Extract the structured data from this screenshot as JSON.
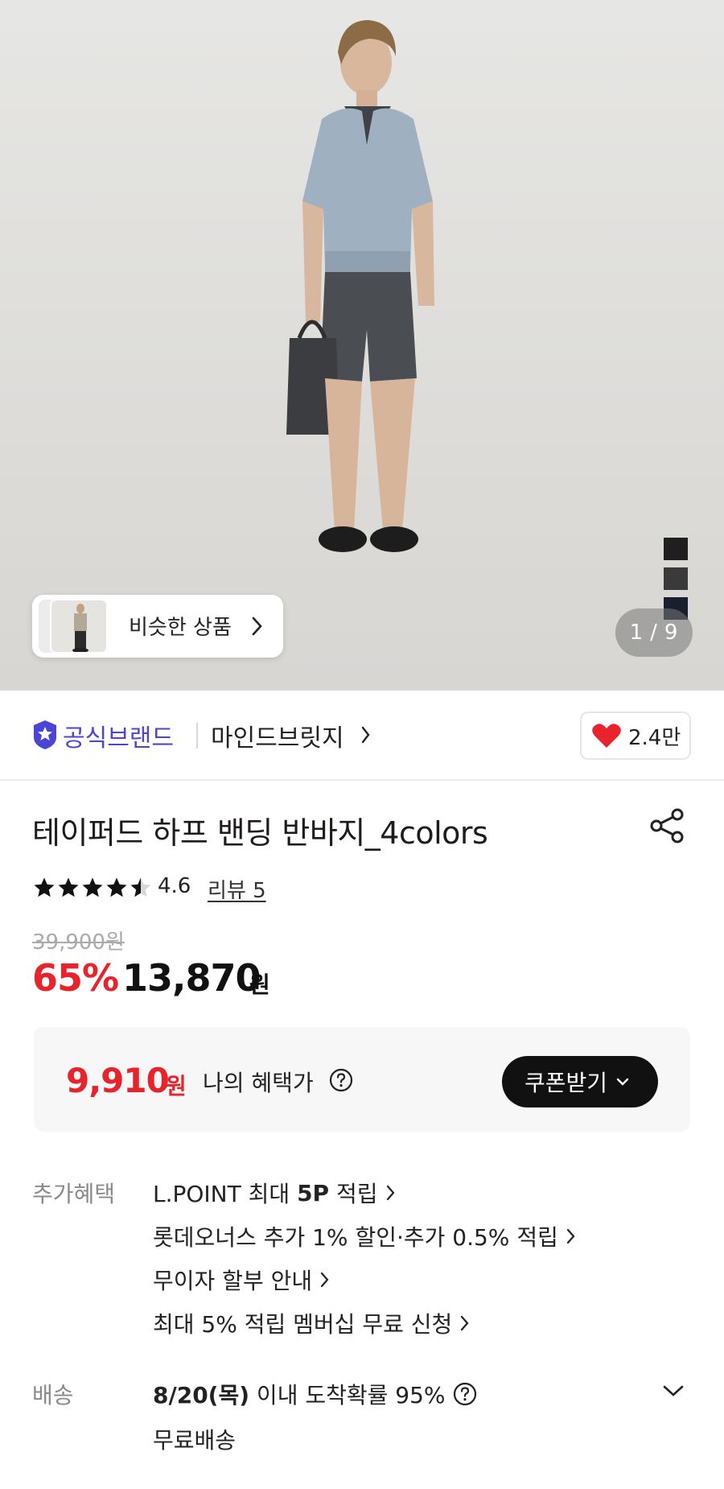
{
  "gallery": {
    "page_current": "1",
    "page_total": "9",
    "page_separator": "/",
    "similar_products_label": "비슷한 상품",
    "color_swatches": [
      "#1f1f1f",
      "#3a3a3a",
      "#1a1f2e"
    ]
  },
  "brand": {
    "official_label": "공식브랜드",
    "name": "마인드브릿지",
    "like_count": "2.4만",
    "accent_color": "#4b45d6"
  },
  "product": {
    "title": "테이퍼드 하프 밴딩 반바지_4colors",
    "rating": "4.6",
    "rating_stars": 4.6,
    "review_label": "리뷰 5",
    "original_price": "39,900원",
    "discount_rate": "65%",
    "sale_price": "13,870",
    "currency_unit": "원"
  },
  "benefit": {
    "price": "9,910",
    "currency_unit": "원",
    "label": "나의 혜택가",
    "coupon_button": "쿠폰받기",
    "accent_color": "#e8232b"
  },
  "extra_benefits": {
    "label": "추가혜택",
    "items": [
      {
        "prefix": "L.POINT 최대 ",
        "bold": "5P",
        "suffix": " 적립"
      },
      {
        "text": "롯데오너스 추가 1% 할인·추가 0.5% 적립"
      },
      {
        "text": "무이자 할부 안내"
      },
      {
        "text": "최대 5% 적립 멤버십 무료 신청"
      }
    ]
  },
  "delivery": {
    "label": "배송",
    "date": "8/20(목)",
    "eta_text": " 이내 도착확률 95%",
    "fee_text": "무료배송"
  }
}
